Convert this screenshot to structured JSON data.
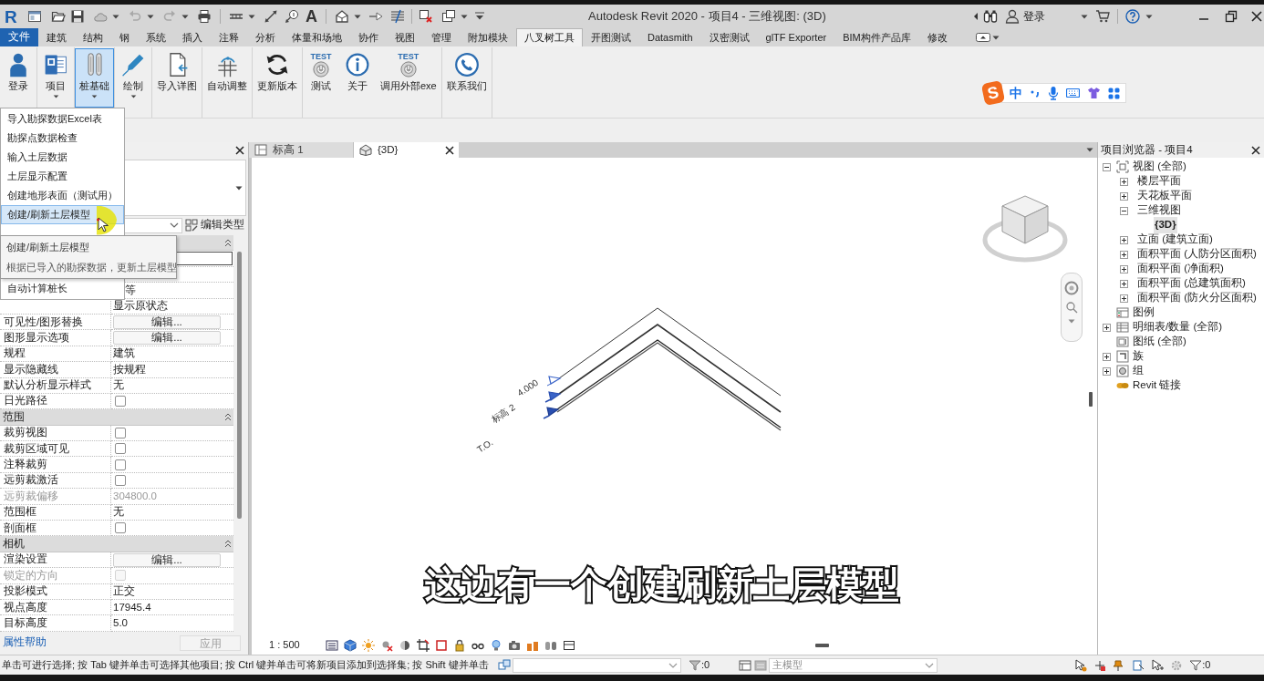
{
  "title_bar": {
    "app_logo": "R",
    "text_tool": "A",
    "title": "Autodesk Revit 2020 - 项目4 - 三维视图: (3D)",
    "sign_in": "登录"
  },
  "ribbon_tabs": [
    {
      "label": "文件",
      "kind": "file",
      "selected": false
    },
    {
      "label": "建筑",
      "kind": "tab",
      "selected": false
    },
    {
      "label": "结构",
      "kind": "tab",
      "selected": false
    },
    {
      "label": "钢",
      "kind": "tab",
      "selected": false
    },
    {
      "label": "系统",
      "kind": "tab",
      "selected": false
    },
    {
      "label": "插入",
      "kind": "tab",
      "selected": false
    },
    {
      "label": "注释",
      "kind": "tab",
      "selected": false
    },
    {
      "label": "分析",
      "kind": "tab",
      "selected": false
    },
    {
      "label": "体量和场地",
      "kind": "tab",
      "selected": false
    },
    {
      "label": "协作",
      "kind": "tab",
      "selected": false
    },
    {
      "label": "视图",
      "kind": "tab",
      "selected": false
    },
    {
      "label": "管理",
      "kind": "tab",
      "selected": false
    },
    {
      "label": "附加模块",
      "kind": "tab",
      "selected": false
    },
    {
      "label": "八叉树工具",
      "kind": "tab",
      "selected": true
    },
    {
      "label": "开图测试",
      "kind": "tab",
      "selected": false
    },
    {
      "label": "Datasmith",
      "kind": "tab",
      "selected": false
    },
    {
      "label": "汉密测试",
      "kind": "tab",
      "selected": false
    },
    {
      "label": "glTF Exporter",
      "kind": "tab",
      "selected": false
    },
    {
      "label": "BIM构件产品库",
      "kind": "tab",
      "selected": false
    },
    {
      "label": "修改",
      "kind": "tab",
      "selected": false
    }
  ],
  "ribbon_panels": [
    {
      "buttons": [
        {
          "label": "登录",
          "kind": "person",
          "dropdown": false,
          "pressed": false
        }
      ]
    },
    {
      "buttons": [
        {
          "label": "项目",
          "kind": "document",
          "dropdown": true,
          "pressed": false
        }
      ]
    },
    {
      "buttons": [
        {
          "label": "桩基础",
          "kind": "piles",
          "dropdown": true,
          "pressed": true
        }
      ]
    },
    {
      "buttons": [
        {
          "label": "绘制",
          "kind": "pen",
          "dropdown": true,
          "pressed": false
        }
      ]
    },
    {
      "buttons": [
        {
          "label": "导入详图",
          "kind": "import",
          "dropdown": false,
          "pressed": false
        }
      ]
    },
    {
      "buttons": [
        {
          "label": "自动调整",
          "kind": "grid",
          "dropdown": false,
          "pressed": false
        }
      ]
    },
    {
      "buttons": [
        {
          "label": "更新版本",
          "kind": "refresh",
          "dropdown": false,
          "pressed": false
        }
      ]
    },
    {
      "buttons": [
        {
          "label": "测试",
          "kind": "power",
          "badge": "TEST",
          "dropdown": false,
          "pressed": false
        },
        {
          "label": "关于",
          "kind": "info",
          "dropdown": false,
          "pressed": false
        },
        {
          "label": "调用外部exe",
          "kind": "power",
          "badge": "TEST",
          "dropdown": false,
          "pressed": false
        }
      ]
    },
    {
      "buttons": [
        {
          "label": "联系我们",
          "kind": "phone",
          "dropdown": false,
          "pressed": false
        }
      ]
    }
  ],
  "pile_menu": {
    "items": [
      {
        "label": "导入勘探数据Excel表",
        "highlighted": false
      },
      {
        "label": "勘探点数据检查",
        "highlighted": false
      },
      {
        "label": "输入土层数据",
        "highlighted": false
      },
      {
        "label": "土层显示配置",
        "highlighted": false
      },
      {
        "label": "创建地形表面（测试用）",
        "highlighted": false
      },
      {
        "label": "创建/刷新土层模型",
        "highlighted": true
      }
    ],
    "last_item": {
      "label": "自动计算桩长",
      "highlighted": false
    },
    "tooltip": {
      "title": "创建/刷新土层模型",
      "description": "根据已导入的勘探数据，更新土层模型"
    }
  },
  "ime_toolbar": {
    "logo": "S",
    "mode": "中"
  },
  "properties": {
    "edit_type": "编辑类型",
    "rows": [
      {
        "kind": "group",
        "expanded": true
      },
      {
        "kind": "field",
        "covered": true,
        "disabled": false
      },
      {
        "kind": "blank"
      },
      {
        "kind": "text",
        "value": "等",
        "covered": true,
        "disabled": false
      },
      {
        "kind": "text",
        "value": "显示原状态",
        "covered": false,
        "disabled": false
      },
      {
        "kind": "button",
        "label": "可见性/图形替换",
        "value": "编辑...",
        "covered": false,
        "disabled": false
      },
      {
        "kind": "button",
        "label": "图形显示选项",
        "value": "编辑...",
        "covered": false,
        "disabled": false
      },
      {
        "kind": "text",
        "label": "规程",
        "value": "建筑",
        "covered": false,
        "disabled": false
      },
      {
        "kind": "text",
        "label": "显示隐藏线",
        "value": "按规程",
        "covered": false,
        "disabled": false
      },
      {
        "kind": "text",
        "label": "默认分析显示样式",
        "value": "无",
        "covered": false,
        "disabled": false
      },
      {
        "kind": "checkbox",
        "label": "日光路径",
        "checked": false,
        "covered": false,
        "disabled": false
      },
      {
        "kind": "group",
        "label": "范围",
        "expanded": true
      },
      {
        "kind": "checkbox",
        "label": "裁剪视图",
        "checked": false,
        "covered": false,
        "disabled": false
      },
      {
        "kind": "checkbox",
        "label": "裁剪区域可见",
        "checked": false,
        "covered": false,
        "disabled": false
      },
      {
        "kind": "checkbox",
        "label": "注释裁剪",
        "checked": false,
        "covered": false,
        "disabled": false
      },
      {
        "kind": "checkbox",
        "label": "远剪裁激活",
        "checked": false,
        "covered": false,
        "disabled": false
      },
      {
        "kind": "text",
        "label": "远剪裁偏移",
        "value": "304800.0",
        "covered": false,
        "disabled": true
      },
      {
        "kind": "text",
        "label": "范围框",
        "value": "无",
        "covered": false,
        "disabled": false
      },
      {
        "kind": "checkbox",
        "label": "剖面框",
        "checked": false,
        "covered": false,
        "disabled": false
      },
      {
        "kind": "group",
        "label": "相机",
        "expanded": true
      },
      {
        "kind": "button",
        "label": "渲染设置",
        "value": "编辑...",
        "covered": false,
        "disabled": false
      },
      {
        "kind": "checkbox",
        "label": "锁定的方向",
        "checked": false,
        "covered": false,
        "disabled": true
      },
      {
        "kind": "text",
        "label": "投影模式",
        "value": "正交",
        "covered": false,
        "disabled": false
      },
      {
        "kind": "text",
        "label": "视点高度",
        "value": "17945.4",
        "covered": false,
        "disabled": false
      },
      {
        "kind": "text",
        "label": "目标高度",
        "value": "5.0",
        "covered": false,
        "disabled": false
      }
    ],
    "help_link": "属性帮助",
    "apply": {
      "label": "应用",
      "disabled": true
    }
  },
  "view_tabs": [
    {
      "label": "标高 1",
      "kind": "plan",
      "selected": false
    },
    {
      "label": "{3D}",
      "kind": "model",
      "selected": true
    }
  ],
  "view": {
    "levels": [
      {
        "name": "标高 2",
        "elevation": "4.000"
      },
      {
        "name": "T.O."
      }
    ],
    "scale": "1 : 500"
  },
  "project_browser": {
    "title": "项目浏览器 - 项目4",
    "tree": [
      {
        "label": "视图 (全部)",
        "kind": "views",
        "expanded": true,
        "selected": false,
        "children": [
          {
            "label": "楼层平面",
            "expanded": false,
            "selected": false
          },
          {
            "label": "天花板平面",
            "expanded": false,
            "selected": false
          },
          {
            "label": "三维视图",
            "expanded": true,
            "selected": false,
            "children": [
              {
                "label": "{3D}",
                "selected": true
              }
            ]
          },
          {
            "label": "立面 (建筑立面)",
            "expanded": false,
            "selected": false
          },
          {
            "label": "面积平面 (人防分区面积)",
            "expanded": false,
            "selected": false
          },
          {
            "label": "面积平面 (净面积)",
            "expanded": false,
            "selected": false
          },
          {
            "label": "面积平面 (总建筑面积)",
            "expanded": false,
            "selected": false
          },
          {
            "label": "面积平面 (防火分区面积)",
            "expanded": false,
            "selected": false
          }
        ]
      },
      {
        "label": "图例",
        "kind": "legend",
        "selected": false
      },
      {
        "label": "明细表/数量 (全部)",
        "kind": "schedule",
        "expanded": false,
        "selected": false
      },
      {
        "label": "图纸 (全部)",
        "kind": "sheet",
        "selected": false
      },
      {
        "label": "族",
        "kind": "family",
        "expanded": false,
        "selected": false
      },
      {
        "label": "组",
        "kind": "group",
        "expanded": false,
        "selected": false
      },
      {
        "label": "Revit 链接",
        "kind": "link",
        "selected": false
      }
    ]
  },
  "subtitle": "这边有一个创建刷新土层模型",
  "status_bar": {
    "hint": "单击可进行选择; 按 Tab 键并单击可选择其他项目; 按 Ctrl 键并单击可将新项目添加到选择集; 按 Shift 键并单击",
    "selection_count": ":0",
    "workset": "主模型",
    "filter_count": ":0"
  }
}
